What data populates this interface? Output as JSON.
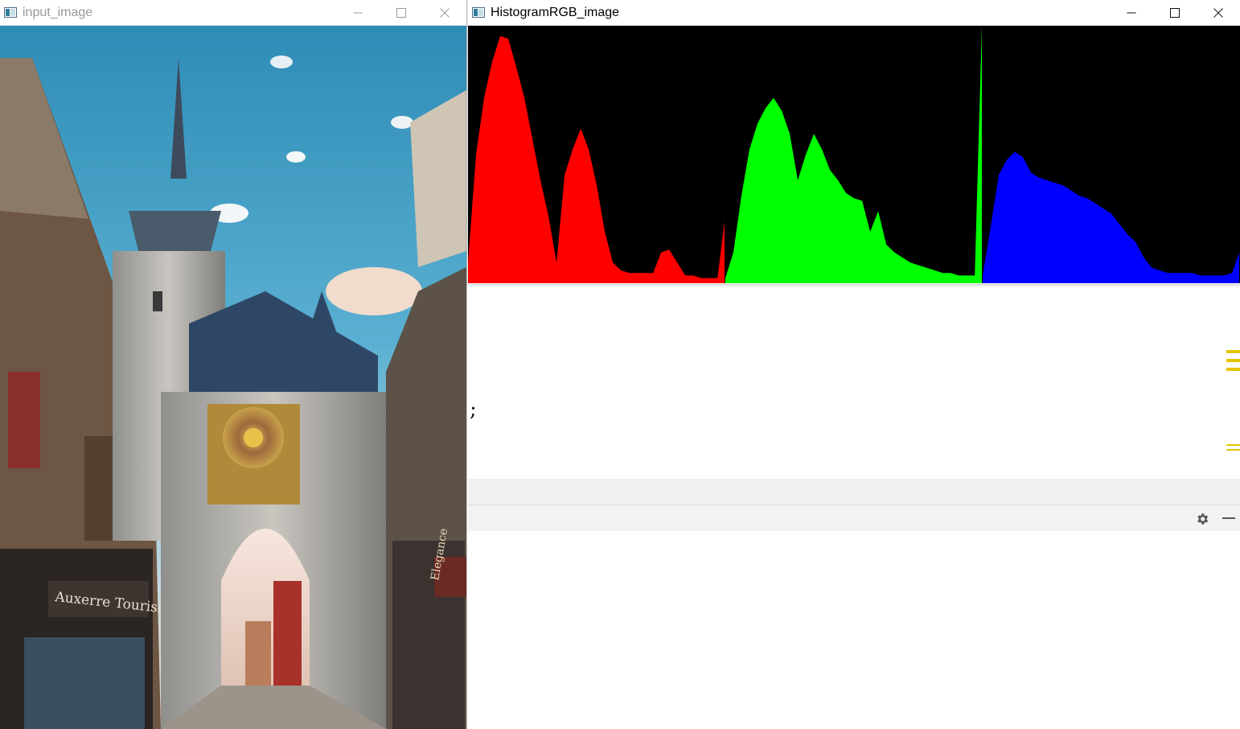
{
  "windows": {
    "input": {
      "title": "input_image",
      "state": "inactive"
    },
    "histogram": {
      "title": "HistogramRGB_image",
      "state": "active"
    }
  },
  "photo": {
    "shop_sign": "Auxerre Tourisme",
    "right_shop_sign": "Elegance"
  },
  "editor": {
    "code_text": ";"
  },
  "icons": {
    "window_icon": "opencv-window-icon",
    "minimize": "minimize-icon",
    "maximize": "maximize-icon",
    "close": "close-icon",
    "settings": "gear-icon",
    "hide_panel": "minus-icon"
  },
  "colors": {
    "red_channel": "#ff0000",
    "green_channel": "#00ff00",
    "blue_channel": "#0000ff",
    "histogram_bg": "#000000",
    "scroll_marker": "#e3c400"
  },
  "chart_data": {
    "type": "area",
    "xlabel": "",
    "ylabel": "",
    "grid": false,
    "legend": "none",
    "xlim": [
      0,
      255
    ],
    "ylim": [
      0,
      100
    ],
    "x": [
      0,
      8,
      16,
      24,
      32,
      40,
      48,
      56,
      64,
      72,
      80,
      88,
      96,
      104,
      112,
      120,
      128,
      136,
      144,
      152,
      160,
      168,
      176,
      184,
      192,
      200,
      208,
      216,
      224,
      232,
      240,
      248,
      255
    ],
    "series": [
      {
        "color": "#ff0000",
        "values": [
          8,
          50,
          72,
          86,
          96,
          95,
          84,
          72,
          56,
          40,
          26,
          8,
          42,
          52,
          60,
          52,
          38,
          20,
          8,
          5,
          4,
          4,
          4,
          4,
          12,
          13,
          8,
          3,
          3,
          2,
          2,
          2,
          24
        ]
      },
      {
        "color": "#00ff00",
        "values": [
          2,
          12,
          34,
          52,
          62,
          68,
          72,
          67,
          58,
          40,
          50,
          58,
          52,
          44,
          40,
          35,
          33,
          32,
          20,
          28,
          15,
          12,
          10,
          8,
          7,
          6,
          5,
          4,
          4,
          3,
          3,
          3,
          100
        ]
      },
      {
        "color": "#0000ff",
        "values": [
          3,
          22,
          42,
          48,
          51,
          49,
          43,
          41,
          40,
          39,
          38,
          36,
          34,
          33,
          31,
          29,
          27,
          23,
          19,
          16,
          10,
          6,
          5,
          4,
          4,
          4,
          4,
          3,
          3,
          3,
          3,
          4,
          12
        ]
      }
    ]
  }
}
